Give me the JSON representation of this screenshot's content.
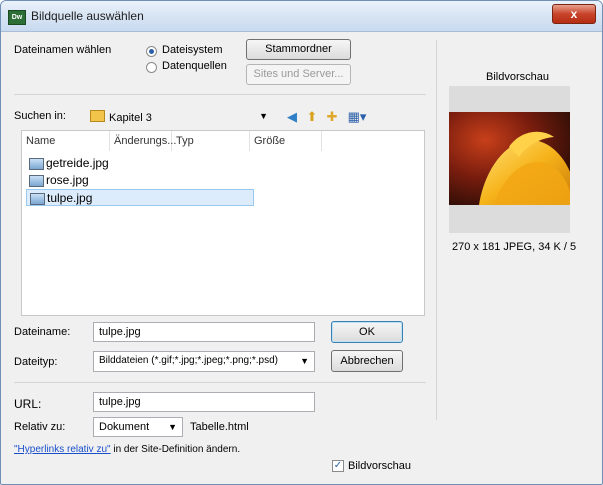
{
  "window": {
    "title": "Bildquelle auswählen",
    "app_icon_text": "Dw",
    "close_glyph": "x"
  },
  "source": {
    "label": "Dateinamen wählen",
    "option_filesystem": "Dateisystem",
    "option_datasources": "Datenquellen",
    "selected": "Dateisystem",
    "root_button": "Stammordner",
    "sites_button": "Sites und Server..."
  },
  "lookin": {
    "label": "Suchen in:",
    "folder": "Kapitel 3"
  },
  "columns": [
    "Name",
    "Änderungs...",
    "Typ",
    "Größe"
  ],
  "files": [
    {
      "name": "getreide.jpg",
      "selected": false
    },
    {
      "name": "rose.jpg",
      "selected": false
    },
    {
      "name": "tulpe.jpg",
      "selected": true
    }
  ],
  "filename": {
    "label": "Dateiname:",
    "value": "tulpe.jpg"
  },
  "filetype": {
    "label": "Dateityp:",
    "value": "Bilddateien (*.gif;*.jpg;*.jpeg;*.png;*.psd)"
  },
  "buttons": {
    "ok": "OK",
    "cancel": "Abbrechen"
  },
  "url": {
    "label": "URL:",
    "value": "tulpe.jpg"
  },
  "relative": {
    "label": "Relativ zu:",
    "value": "Dokument",
    "file": "Tabelle.html"
  },
  "hint": {
    "link": "\"Hyperlinks relativ zu\"",
    "text": " in der Site-Definition ändern."
  },
  "preview": {
    "heading": "Bildvorschau",
    "info": "270 x 181 JPEG, 34 K / 5",
    "checkbox_label": "Bildvorschau",
    "checked": true
  },
  "colors": {
    "accent": "#2a5fa8",
    "selection": "#dcecfc",
    "link": "#1a4fcc"
  }
}
